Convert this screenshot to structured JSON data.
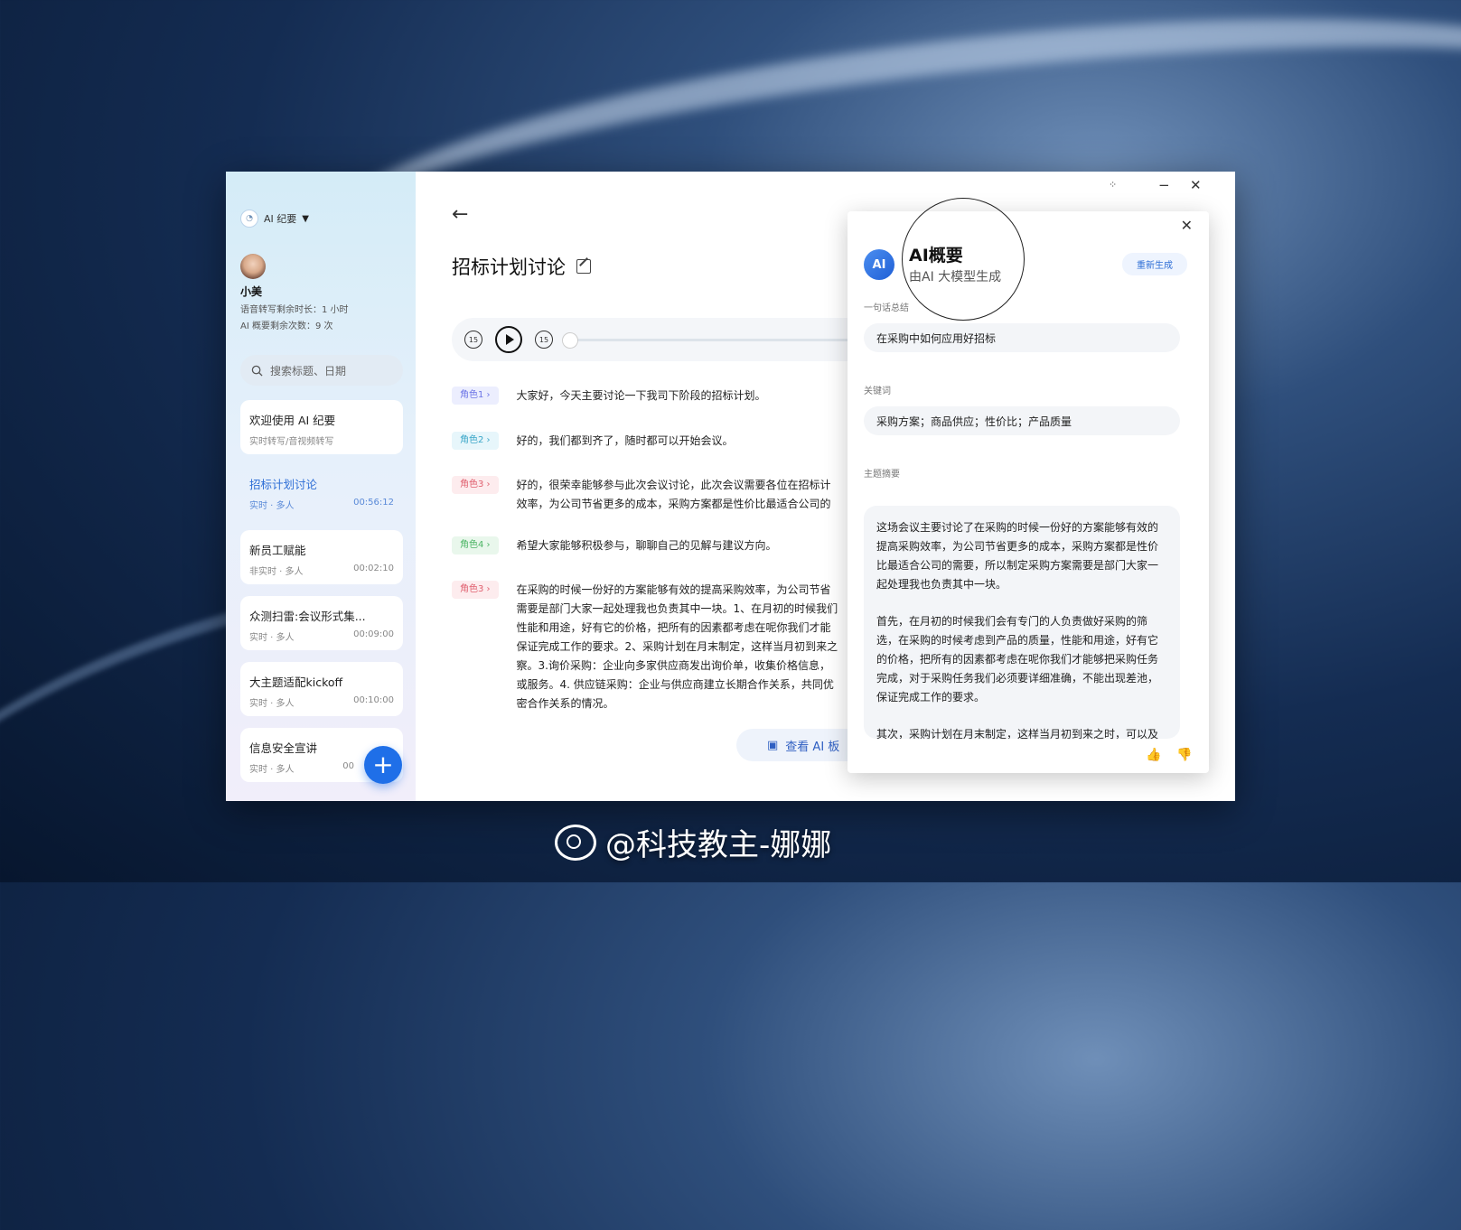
{
  "app": {
    "name": "AI 纪要"
  },
  "user": {
    "name": "小美",
    "voice_quota": "语音转写剩余时长：1 小时",
    "summary_quota": "AI 概要剩余次数：9 次"
  },
  "search": {
    "placeholder": "搜索标题、日期"
  },
  "recordings": [
    {
      "title": "欢迎使用 AI 纪要",
      "meta": "实时转写/音视频转写",
      "duration": ""
    },
    {
      "title": "招标计划讨论",
      "meta": "实时 · 多人",
      "duration": "00:56:12"
    },
    {
      "title": "新员工赋能",
      "meta": "非实时 · 多人",
      "duration": "00:02:10"
    },
    {
      "title": "众测扫雷:会议形式集...",
      "meta": "实时 · 多人",
      "duration": "00:09:00"
    },
    {
      "title": "大主题适配kickoff",
      "meta": "实时 · 多人",
      "duration": "00:10:00"
    },
    {
      "title": "信息安全宣讲",
      "meta": "实时 · 多人",
      "duration": "00"
    }
  ],
  "meeting": {
    "title": "招标计划讨论"
  },
  "player": {
    "rewind_label": "15",
    "forward_label": "15",
    "progress": 0.0
  },
  "transcript": [
    {
      "role": "角色1 ›",
      "text": "大家好，今天主要讨论一下我司下阶段的招标计划。"
    },
    {
      "role": "角色2 ›",
      "text": "好的，我们都到齐了，随时都可以开始会议。"
    },
    {
      "role": "角色3 ›",
      "text": "好的，很荣幸能够参与此次会议讨论，此次会议需要各位在招标计\n效率，为公司节省更多的成本，采购方案都是性价比最适合公司的"
    },
    {
      "role": "角色4 ›",
      "text": "希望大家能够积极参与，聊聊自己的见解与建议方向。"
    },
    {
      "role": "角色3 ›",
      "text": "在采购的时候一份好的方案能够有效的提高采购效率，为公司节省\n需要是部门大家一起处理我也负责其中一块。1、在月初的时候我们\n性能和用途，好有它的价格，把所有的因素都考虑在呢你我们才能\n保证完成工作的要求。2、采购计划在月末制定，这样当月初到来之\n察。3.询价采购：企业向多家供应商发出询价单，收集价格信息，\n或服务。4. 供应链采购：企业与供应商建立长期合作关系，共同优\n密合作关系的情况。"
    }
  ],
  "view_ai_button": {
    "label": "查看 AI 板"
  },
  "ai_panel": {
    "title": "AI概要",
    "subtitle": "由AI 大模型生成",
    "regenerate": "重新生成",
    "one_sentence_label": "一句话总结",
    "one_sentence": "在采购中如何应用好招标",
    "keywords_label": "关键词",
    "keywords": "采购方案；商品供应；性价比；产品质量",
    "topic_label": "主题摘要",
    "topic_paragraphs": [
      "这场会议主要讨论了在采购的时候一份好的方案能够有效的提高采购效率，为公司节省更多的成本，采购方案都是性价比最适合公司的需要，所以制定采购方案需要是部门大家一起处理我也负责其中一块。",
      "首先，在月初的时候我们会有专门的人负责做好采购的筛选，在采购的时候考虑到产品的质量，性能和用途，好有它的价格，把所有的因素都考虑在呢你我们才能够把采购任务完成，对于采购任务我们必须要详细准确，不能出现差池，保证完成工作的要求。",
      "其次，采购计划在月末制定，这样当月初到来之时，可以及时"
    ]
  },
  "watermark": {
    "text": "@科技教主-娜娜"
  }
}
